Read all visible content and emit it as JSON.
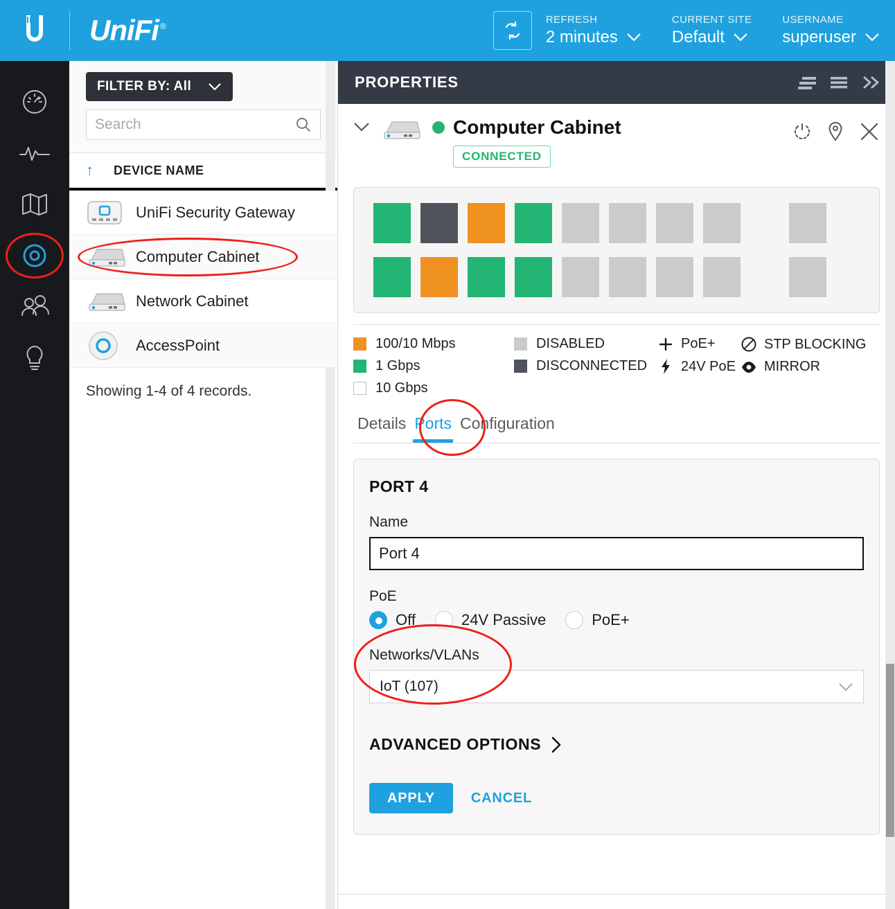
{
  "topbar": {
    "brand": "UniFi",
    "brand_reg": "®",
    "refresh": {
      "label": "REFRESH",
      "value": "2 minutes",
      "icon": "refresh-icon"
    },
    "current_site": {
      "label": "CURRENT SITE",
      "value": "Default"
    },
    "username": {
      "label": "USERNAME",
      "value": "superuser"
    }
  },
  "rail": {
    "items": [
      {
        "name": "dashboard",
        "icon": "gauge-icon",
        "active": false
      },
      {
        "name": "statistics",
        "icon": "pulse-icon",
        "active": false
      },
      {
        "name": "map",
        "icon": "map-icon",
        "active": false
      },
      {
        "name": "devices",
        "icon": "target-icon",
        "active": true
      },
      {
        "name": "clients",
        "icon": "people-icon",
        "active": false
      },
      {
        "name": "insights",
        "icon": "lightbulb-icon",
        "active": false
      }
    ]
  },
  "device_list": {
    "filter_label": "FILTER BY: All",
    "search_placeholder": "Search",
    "search_value": "",
    "sort_arrow": "↑",
    "column_header": "DEVICE NAME",
    "rows": [
      {
        "name": "UniFi Security Gateway",
        "icon": "gateway-icon",
        "selected": false
      },
      {
        "name": "Computer Cabinet",
        "icon": "switch-icon",
        "selected": true
      },
      {
        "name": "Network Cabinet",
        "icon": "switch-icon",
        "selected": false
      },
      {
        "name": "AccessPoint",
        "icon": "access-point-icon",
        "selected": false
      }
    ],
    "records_text": "Showing 1-4 of 4 records."
  },
  "properties": {
    "panel_title": "PROPERTIES",
    "head_icons": [
      "align-right-icon",
      "hamburger-icon",
      "double-chevron-right-icon"
    ],
    "device": {
      "name": "Computer Cabinet",
      "status_dot_color": "#22b573",
      "status_badge": "CONNECTED",
      "icon": "switch-icon",
      "actions": [
        "restart-icon",
        "locate-icon",
        "close-icon"
      ]
    },
    "ports": {
      "row1": [
        "1gbps",
        "disconnected",
        "100mbps",
        "1gbps",
        "disabled",
        "disabled",
        "disabled",
        "disabled",
        "sfp-disabled"
      ],
      "row2": [
        "1gbps",
        "100mbps",
        "1gbps",
        "1gbps",
        "disabled",
        "disabled",
        "disabled",
        "disabled",
        "sfp-disabled"
      ]
    },
    "legend": {
      "col1": [
        {
          "label": "100/10 Mbps",
          "color": "#ef9121",
          "type": "swatch"
        },
        {
          "label": "1 Gbps",
          "color": "#22b573",
          "type": "swatch"
        },
        {
          "label": "10 Gbps",
          "color": "#ffffff",
          "type": "swatch-outline"
        }
      ],
      "col2": [
        {
          "label": "DISABLED",
          "color": "#cbcbcb",
          "type": "swatch"
        },
        {
          "label": "DISCONNECTED",
          "color": "#4f545c",
          "type": "swatch"
        }
      ],
      "col3": [
        {
          "label": "PoE+",
          "glyph": "plus-icon"
        },
        {
          "label": "24V PoE",
          "glyph": "bolt-icon"
        }
      ],
      "col4": [
        {
          "label": "STP BLOCKING",
          "glyph": "no-entry-icon"
        },
        {
          "label": "MIRROR",
          "glyph": "eye-icon"
        }
      ]
    },
    "tabs": [
      {
        "label": "Details",
        "active": false
      },
      {
        "label": "Ports",
        "active": true
      },
      {
        "label": "Configuration",
        "active": false
      }
    ],
    "port_card": {
      "title": "PORT 4",
      "name_label": "Name",
      "name_value": "Port 4",
      "poe_label": "PoE",
      "poe_options": [
        {
          "label": "Off",
          "selected": true
        },
        {
          "label": "24V Passive",
          "selected": false
        },
        {
          "label": "PoE+",
          "selected": false
        }
      ],
      "vlan_label": "Networks/VLANs",
      "vlan_value": "IoT (107)",
      "advanced_label": "ADVANCED OPTIONS",
      "apply_label": "APPLY",
      "cancel_label": "CANCEL"
    }
  },
  "colors": {
    "brand_blue": "#1ea1de",
    "dark_header": "#343a46",
    "rail_bg": "#18191c",
    "green": "#22b573",
    "orange": "#ef9121",
    "gray": "#cbcbcb",
    "slate": "#4f545c",
    "annotation_red": "#ee1f19"
  }
}
